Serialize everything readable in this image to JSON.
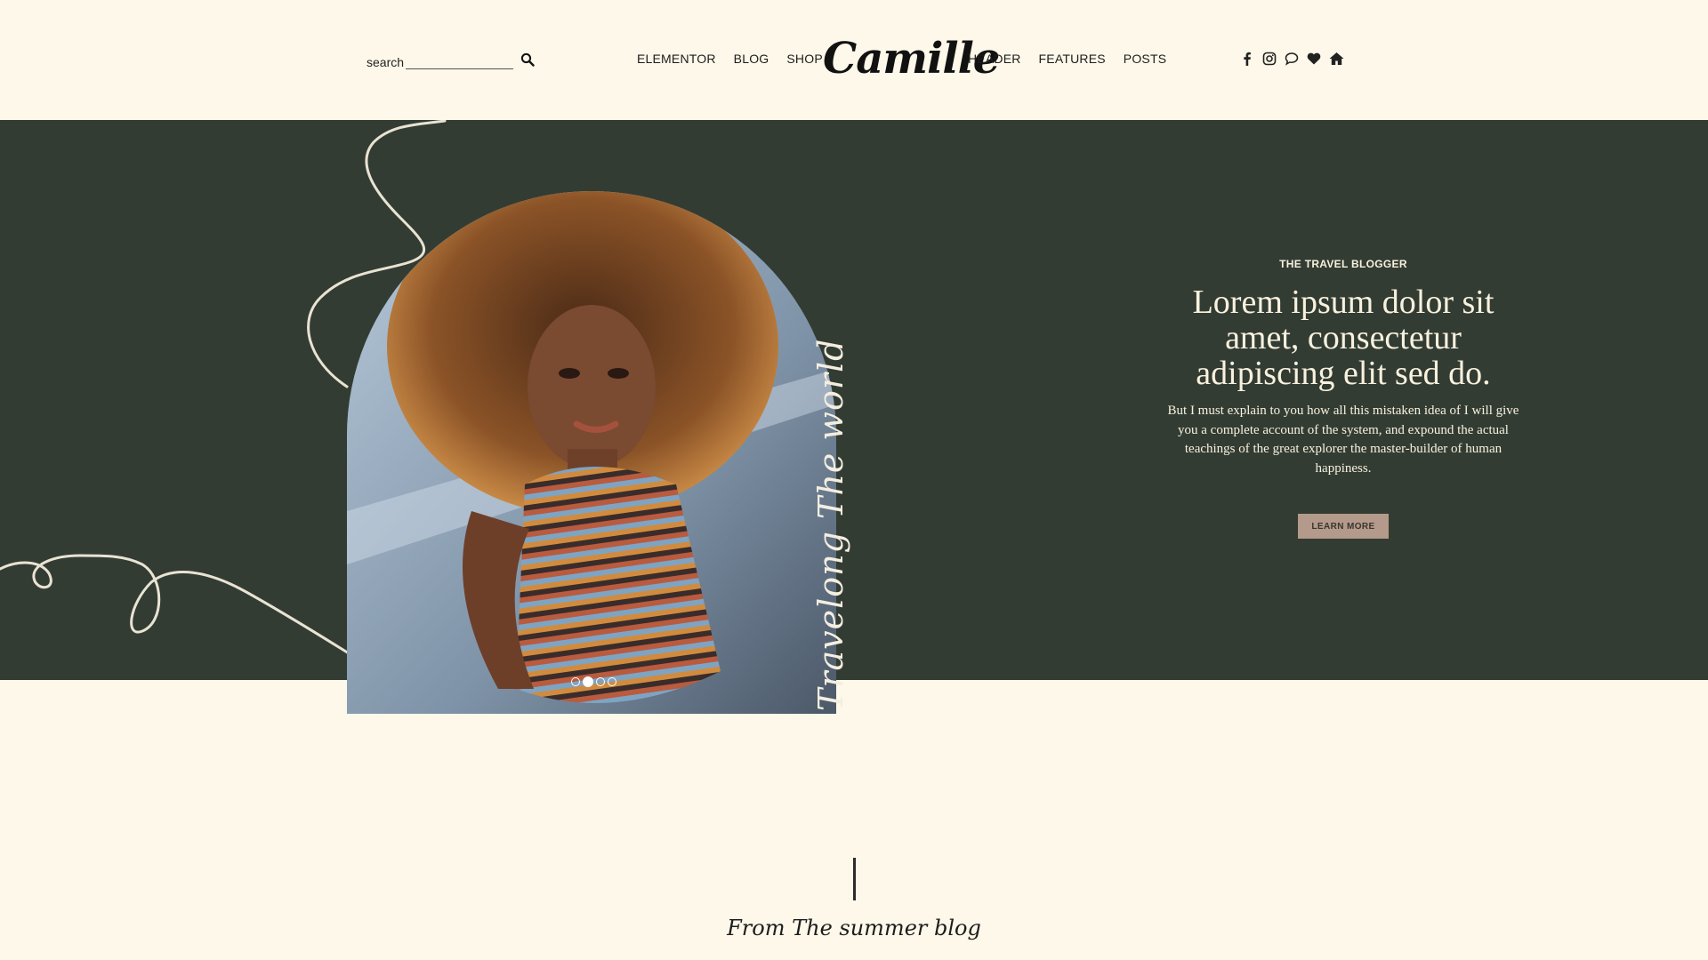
{
  "header": {
    "search": {
      "label": "search",
      "value": "",
      "placeholder": ""
    },
    "nav_left": [
      "ELEMENTOR",
      "BLOG",
      "SHOP"
    ],
    "logo": "Camille",
    "nav_right": [
      "HEADER",
      "FEATURES",
      "POSTS"
    ],
    "social_icons": [
      "facebook-icon",
      "instagram-icon",
      "chat-icon",
      "heart-icon",
      "home-icon"
    ]
  },
  "hero": {
    "eyebrow": "THE TRAVEL BLOGGER",
    "headline": "Lorem ipsum dolor sit amet, consectetur adipiscing elit sed do.",
    "body": "But I must explain to you how all this mistaken idea of I will give you a complete account of the system, and expound the actual teachings of the great explorer the master-builder of human happiness.",
    "button_label": "LEARN MORE",
    "image_script": "Travelong The world",
    "slider": {
      "count": 4,
      "active_index": 1
    }
  },
  "section": {
    "script_title": "From The summer blog"
  },
  "colors": {
    "background": "#fdf8e9",
    "hero_green": "#333c33",
    "button": "#b39a8a",
    "hero_text": "#f7f1de"
  }
}
